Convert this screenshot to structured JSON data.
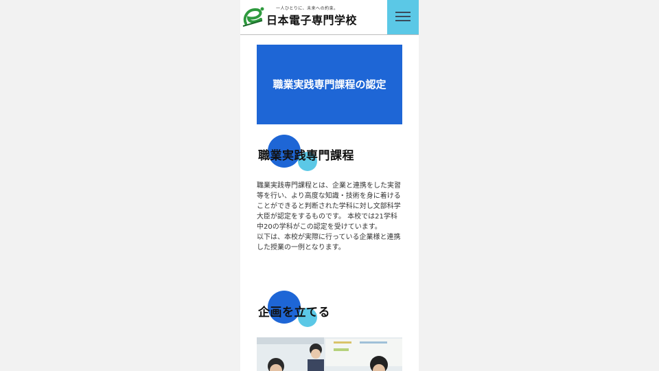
{
  "header": {
    "tagline": "一人ひとりに、未来への約束。",
    "school_name": "日本電子専門学校",
    "menu_icon": "hamburger-menu-icon"
  },
  "hero": {
    "title": "職業実践専門課程の認定"
  },
  "section1": {
    "title": "職業実践専門課程",
    "paragraphs": [
      "職業実践専門課程とは、企業と連携をした実習等を行い、より高度な知識・技術を身に着けることができると判断された学科に対し文部科学大臣が認定をするものです。 本校では21学科中20の学科がこの認定を受けています。",
      "以下は、本校が実際に行っている企業様と連携した授業の一例となります。"
    ]
  },
  "section2": {
    "title": "企画を立てる"
  },
  "colors": {
    "primary_blue": "#1e66d6",
    "accent_cyan": "#5bc8e6",
    "logo_green": "#2e9a3e"
  }
}
